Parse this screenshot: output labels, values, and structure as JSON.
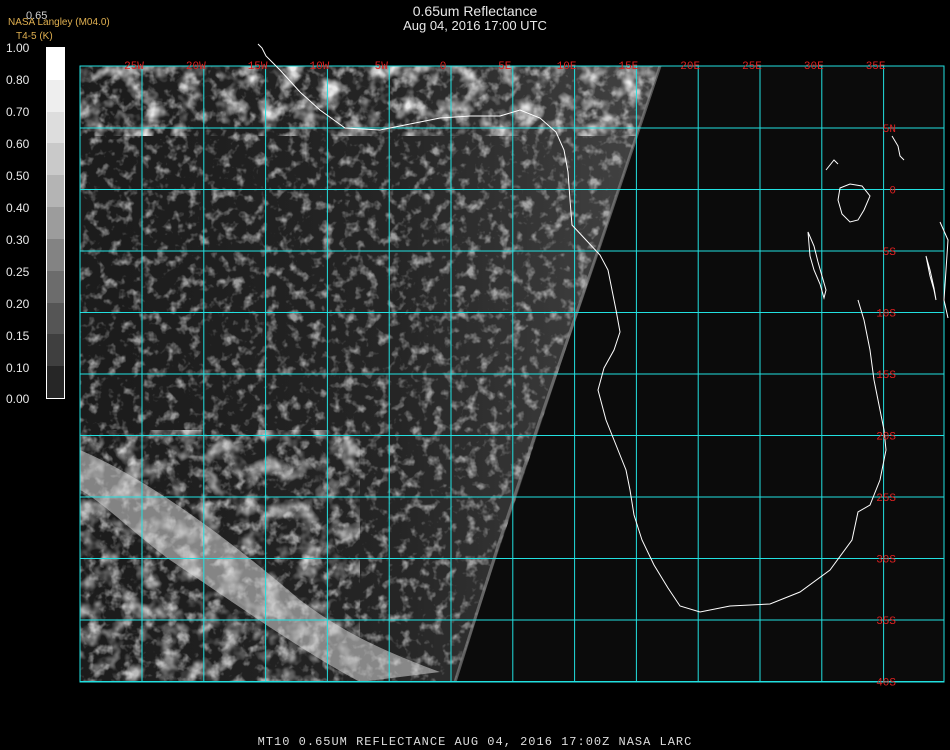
{
  "header": {
    "title": "0.65um Reflectance",
    "datetime": "Aug 04, 2016 17:00 UTC",
    "org_tag": "NASA Langley (M04.0)",
    "sub_tag": "T4-5 (K)",
    "value_readout": "0.65"
  },
  "colorbar": {
    "labels": [
      "1.00",
      "0.80",
      "0.70",
      "0.60",
      "0.50",
      "0.40",
      "0.30",
      "0.25",
      "0.20",
      "0.15",
      "0.10",
      "0.00"
    ],
    "levels": [
      "#ffffff",
      "#eeeeee",
      "#dddddd",
      "#c9c9c9",
      "#b4b4b4",
      "#9c9c9c",
      "#838383",
      "#6c6c6c",
      "#555555",
      "#3f3f3f",
      "#262626"
    ]
  },
  "map": {
    "lon_labels": [
      "25W",
      "20W",
      "15W",
      "10W",
      "5W",
      "0",
      "5E",
      "10E",
      "15E",
      "20E",
      "25E",
      "30E",
      "35E"
    ],
    "lat_labels": [
      "5N",
      "0",
      "5S",
      "10S",
      "15S",
      "20S",
      "25S",
      "30S",
      "35S",
      "40S"
    ],
    "grid_color": "#22e0e0",
    "label_color": "#e02020",
    "coast_color": "#ffffff"
  },
  "footer": {
    "text": "MT10  0.65UM REFLECTANCE   AUG 04, 2016 17:00Z   NASA LARC"
  }
}
